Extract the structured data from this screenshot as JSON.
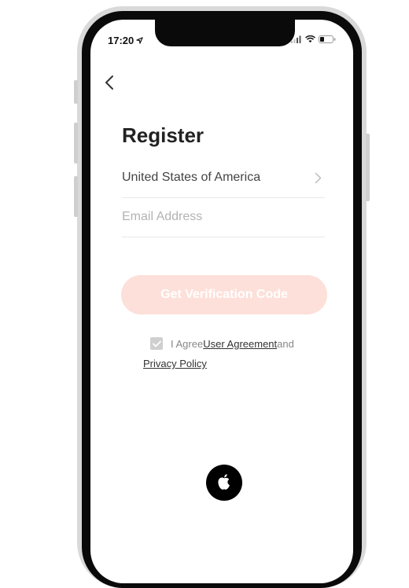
{
  "status_bar": {
    "time": "17:20",
    "location_icon": "location-arrow-icon",
    "signal_icon": "cellular-signal-icon",
    "wifi_icon": "wifi-icon",
    "battery_icon": "battery-icon"
  },
  "nav": {
    "back_icon": "chevron-left-icon"
  },
  "title": "Register",
  "country": {
    "value": "United States of America",
    "chevron_icon": "chevron-right-icon"
  },
  "email": {
    "placeholder": "Email Address",
    "value": ""
  },
  "verify_button": {
    "label": "Get Verification Code"
  },
  "agreement": {
    "prefix": "I Agree",
    "user_agreement": "User Agreement",
    "and": "and",
    "privacy_policy": "Privacy Policy",
    "checked": true
  },
  "social_login": {
    "apple_icon": "apple-logo-icon"
  },
  "colors": {
    "button_bg": "#fde0d9",
    "button_text": "#ffffff",
    "checkbox_bg": "#cfcfcf"
  }
}
